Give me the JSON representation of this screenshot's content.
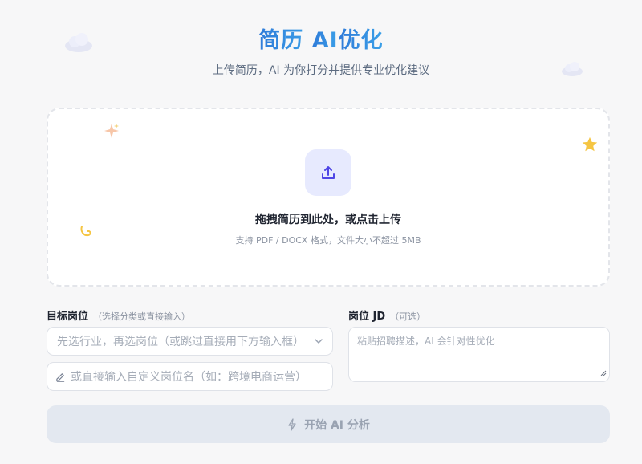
{
  "header": {
    "title_prefix": "简历 ",
    "title_ai": "AI",
    "title_suffix": "优化",
    "subtitle": "上传简历，AI 为你打分并提供专业优化建议"
  },
  "upload": {
    "title": "拖拽简历到此处，或点击上传",
    "hint": "支持 PDF / DOCX 格式，文件大小不超过 5MB"
  },
  "form": {
    "position_label": "目标岗位",
    "position_hint": "（选择分类或直接输入）",
    "select_placeholder": "先选行业，再选岗位（或跳过直接用下方输入框）",
    "custom_placeholder": "或直接输入自定义岗位名（如：跨境电商运营）",
    "jd_label": "岗位 JD",
    "jd_hint": "（可选）",
    "jd_placeholder": "粘贴招聘描述，AI 会针对性优化"
  },
  "submit": {
    "label": "开始 AI 分析"
  },
  "colors": {
    "accent": "#3b82f6",
    "upload_icon_bg": "#e7eafe",
    "upload_icon": "#4f46e5",
    "button_disabled_bg": "#e3e8f0",
    "star": "#f5c542"
  },
  "icons": [
    "cloud-icon",
    "upload-icon",
    "sparkle-icon",
    "star-icon",
    "swirl-icon",
    "chevron-down-icon",
    "pencil-icon",
    "lightning-icon",
    "resize-handle-icon"
  ]
}
